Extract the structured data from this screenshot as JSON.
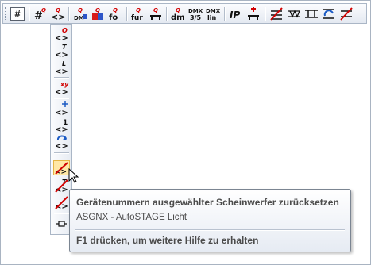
{
  "tooltip": {
    "title": "Gerätenummern ausgewählter Scheinwerfer zurücksetzen",
    "description": "ASGNX - AutoSTAGE Licht",
    "help": "F1 drücken, um weitere Hilfe zu erhalten"
  },
  "toolbar": {
    "hash_label": "#",
    "dmx_label": "DMX",
    "ip_label": "IP",
    "dm_label": "dm",
    "fur_label": "fur",
    "fo_label": "fo",
    "three_five": "3/5",
    "lin_label": "lin",
    "q_label": "Q"
  },
  "vtoolbar": {
    "q_label": "Q",
    "t_label": "T",
    "l_label": "L",
    "xy_label": "xy",
    "one_label": "1"
  },
  "colors": {
    "accent_red": "#d10000",
    "highlight": "#ffe8a6",
    "toolbar_border": "#aab6c6"
  }
}
